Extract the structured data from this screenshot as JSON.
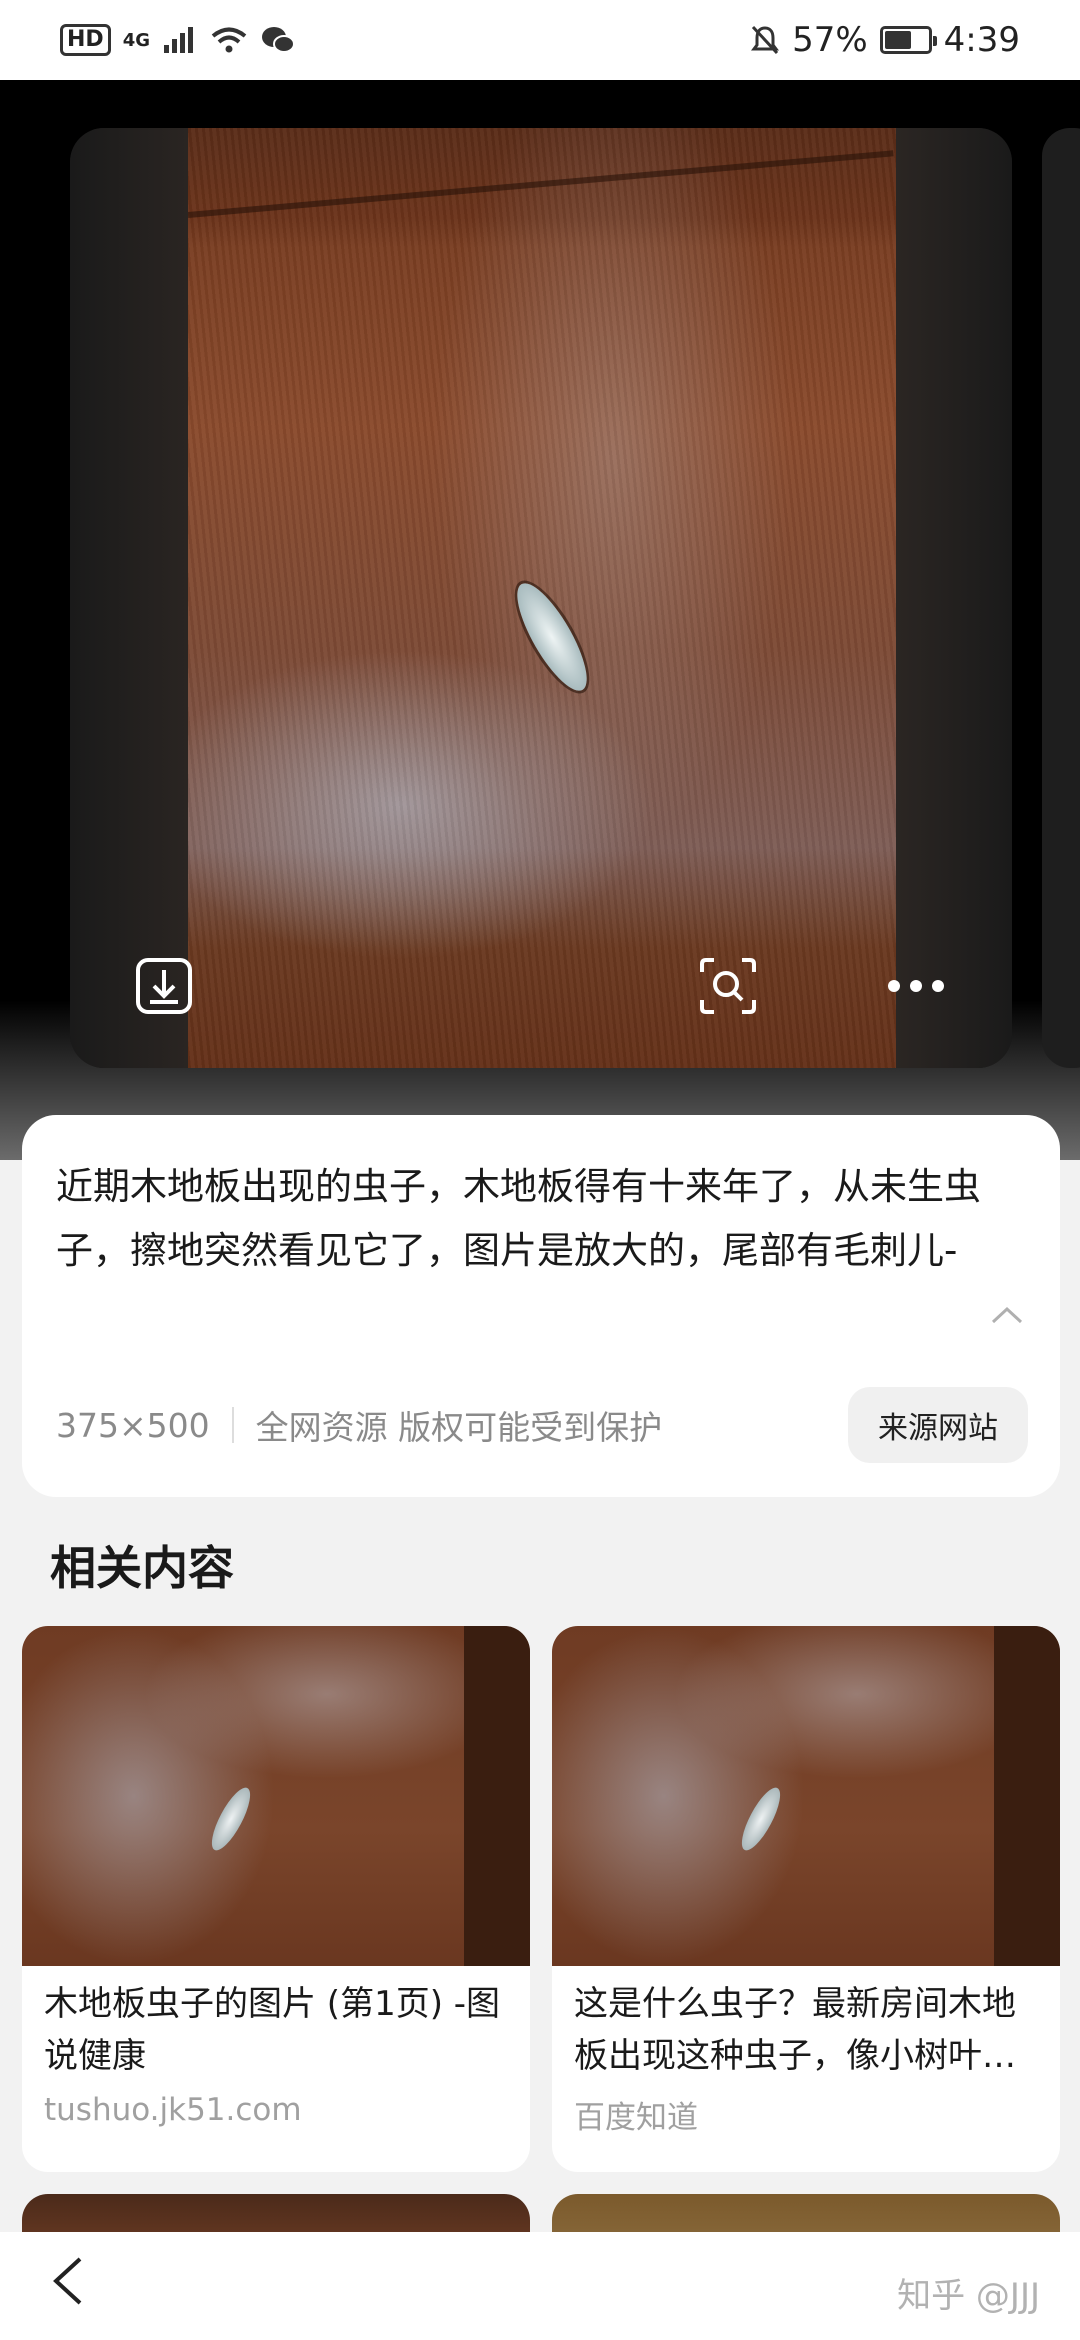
{
  "status_bar": {
    "left": {
      "hd": "HD",
      "network": "4G"
    },
    "right": {
      "battery": "57%",
      "time": "4:39"
    },
    "icons": [
      "signal-icon",
      "wifi-icon",
      "wechat-icon",
      "mute-bell-icon",
      "battery-icon"
    ]
  },
  "viewer": {
    "actions": {
      "download": "download-icon",
      "lens": "visual-search-icon",
      "more": "more-icon"
    }
  },
  "info_card": {
    "description": "近期木地板出现的虫子，木地板得有十来年了，从未生虫子，擦地突然看见它了，图片是放大的，尾部有毛刺儿-",
    "size": "375×500",
    "copyright": "全网资源 版权可能受到保护",
    "source_button": "来源网站"
  },
  "related": {
    "title": "相关内容",
    "items": [
      {
        "title": "木地板虫子的图片 (第1页) -图说健康",
        "source": "tushuo.jk51.com"
      },
      {
        "title": "这是什么虫子？最新房间木地板出现这种虫子，像小树叶…",
        "source": "百度知道"
      }
    ]
  },
  "nav": {
    "back_icon": "back-chevron-icon"
  },
  "watermark": "知乎 @JJJ"
}
